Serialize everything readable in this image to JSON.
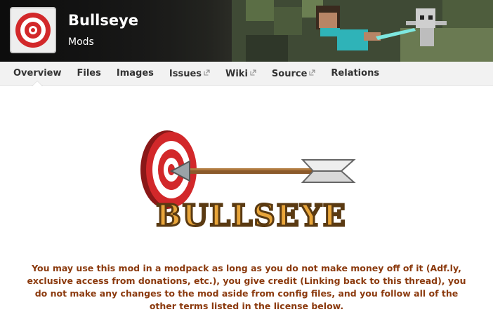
{
  "project": {
    "title": "Bullseye",
    "category": "Mods",
    "logo_icon": "target-icon",
    "hero_text": "BULLSEYE"
  },
  "tabs": [
    {
      "label": "Overview",
      "external": false,
      "active": true
    },
    {
      "label": "Files",
      "external": false,
      "active": false
    },
    {
      "label": "Images",
      "external": false,
      "active": false
    },
    {
      "label": "Issues",
      "external": true,
      "active": false
    },
    {
      "label": "Wiki",
      "external": true,
      "active": false
    },
    {
      "label": "Source",
      "external": true,
      "active": false
    },
    {
      "label": "Relations",
      "external": false,
      "active": false
    }
  ],
  "description": {
    "notice": "You may use this mod in a modpack as long as you do not make money off of it (Adf.ly, exclusive access from donations, etc.), you give credit (Linking back to this thread), you do not make any changes to the mod aside from config files, and you follow all of the other terms listed in the license below."
  },
  "colors": {
    "notice_text": "#8b3a0e",
    "target_red": "#d2282a",
    "tab_bar": "#f2f2f2"
  }
}
